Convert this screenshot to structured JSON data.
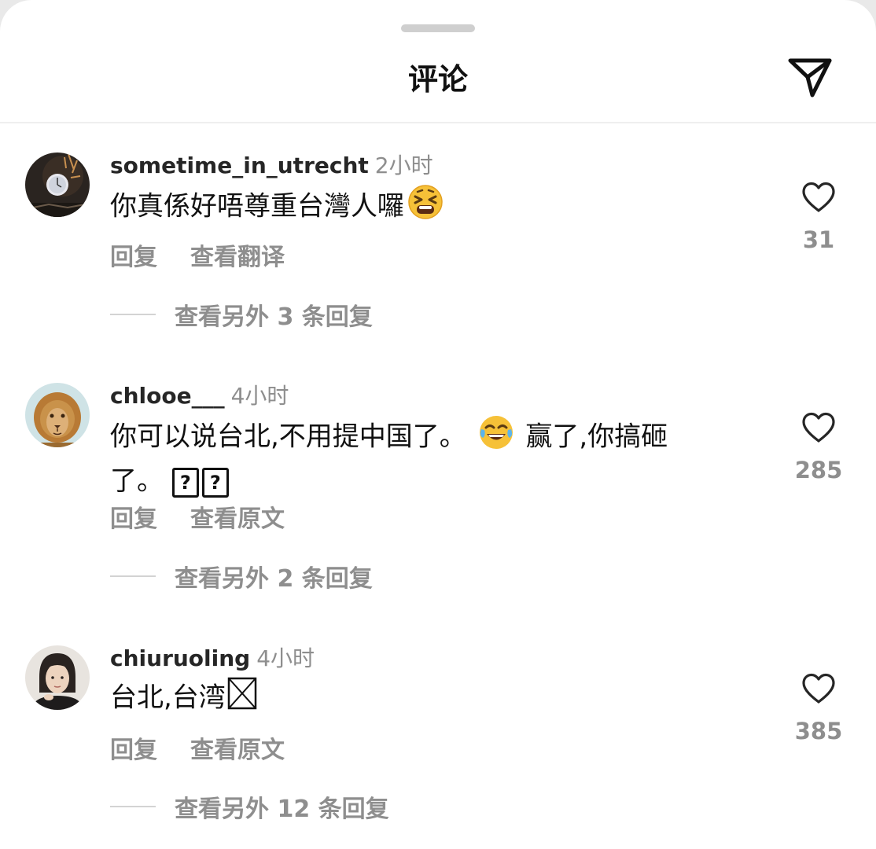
{
  "header": {
    "title": "评论",
    "share_icon": "paper-plane-icon"
  },
  "comments": [
    {
      "username": "sometime_in_utrecht",
      "time": "2小时",
      "text": "你真係好唔尊重台灣人囉",
      "emoji": "tired-face-emoji",
      "actions": [
        "回复",
        "查看翻译"
      ],
      "likes": "31",
      "view_replies": "查看另外 3 条回复"
    },
    {
      "username": "chlooe___",
      "time": "4小时",
      "text_part1": "你可以说台北,不用提中国了。",
      "emoji": "tears-of-joy-emoji",
      "text_part2": "赢了,你搞砸",
      "text_part3": "了。",
      "placeholder_glyphs": [
        "?",
        "?"
      ],
      "actions": [
        "回复",
        "查看原文"
      ],
      "likes": "285",
      "view_replies": "查看另外 2 条回复"
    },
    {
      "username": "chiuruoling",
      "time": "4小时",
      "text": "台北,台湾",
      "placeholder_glyph": "missing-glyph-box",
      "actions": [
        "回复",
        "查看原文"
      ],
      "likes": "385",
      "view_replies": "查看另外 12 条回复"
    }
  ],
  "icons": {
    "like": "heart-outline-icon"
  },
  "colors": {
    "text": "#111111",
    "secondary": "#8e8e8e",
    "divider": "#efefef"
  }
}
